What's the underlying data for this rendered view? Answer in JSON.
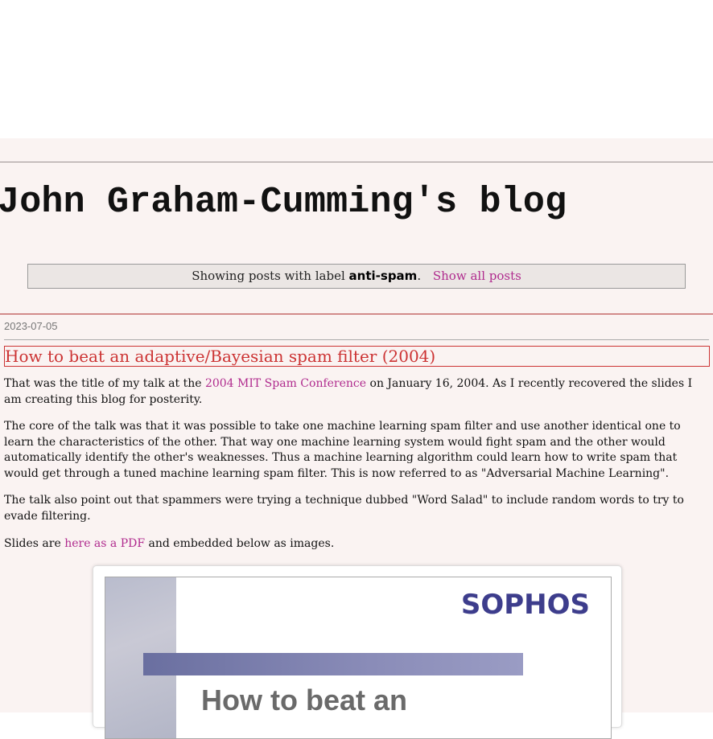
{
  "blog": {
    "title": "John Graham-Cumming's blog"
  },
  "status": {
    "prefix": "Showing posts with label",
    "label": "anti-spam",
    "suffix": ".",
    "show_all": "Show all posts"
  },
  "post": {
    "date": "2023-07-05",
    "title": "How to beat an adaptive/Bayesian spam filter (2004)",
    "p1": {
      "before": "That was the title of my talk at the ",
      "link": "2004 MIT Spam Conference",
      "after": " on January 16, 2004. As I recently recovered the slides I am creating this blog for posterity."
    },
    "p2": "The core of the talk was that it was possible to take one machine learning spam filter and use another identical one to learn the characteristics of the other. That way one machine learning system would fight spam and the other would automatically identify the other's weaknesses. Thus a machine learning algorithm could learn how to write spam that would get through a tuned machine learning spam filter. This is now referred to as \"Adversarial Machine Learning\".",
    "p3": "The talk also point out that spammers were trying a technique dubbed \"Word Salad\" to include random words to try to evade filtering.",
    "p4": {
      "before": "Slides are ",
      "link": "here as a PDF",
      "after": " and embedded below as images."
    }
  },
  "slide": {
    "logo": "SOPHOS",
    "heading": "How to beat an"
  }
}
